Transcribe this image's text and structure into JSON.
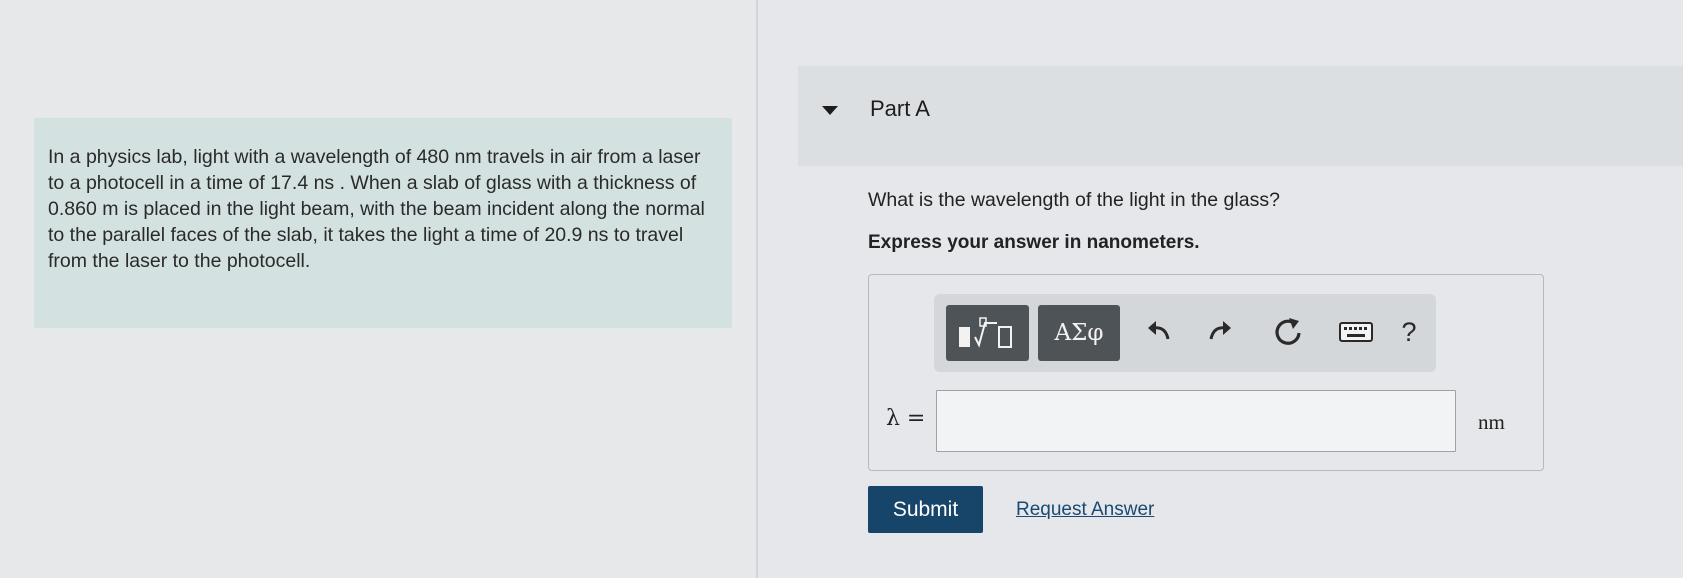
{
  "problem": {
    "text": "In a physics lab, light with a wavelength of 480 nm travels in air from a laser to a photocell in a time of 17.4 ns . When a slab of glass with a thickness of 0.860 m is placed in the light beam, with the beam incident along the normal to the parallel faces of the slab, it takes the light a time of 20.9 ns to travel from the laser to the photocell."
  },
  "part": {
    "title": "Part A",
    "question": "What is the wavelength of the light in the glass?",
    "instruction": "Express your answer in nanometers."
  },
  "toolbar": {
    "symbols_label": "ΑΣφ",
    "help_label": "?"
  },
  "answer": {
    "variable_label": "λ =",
    "value": "",
    "unit": "nm"
  },
  "actions": {
    "submit_label": "Submit",
    "request_label": "Request Answer"
  },
  "colors": {
    "submit_bg": "#17456a",
    "problem_bg": "#d3e2e0",
    "toolbar_button_bg": "#4e5357",
    "link": "#1a4a73"
  }
}
